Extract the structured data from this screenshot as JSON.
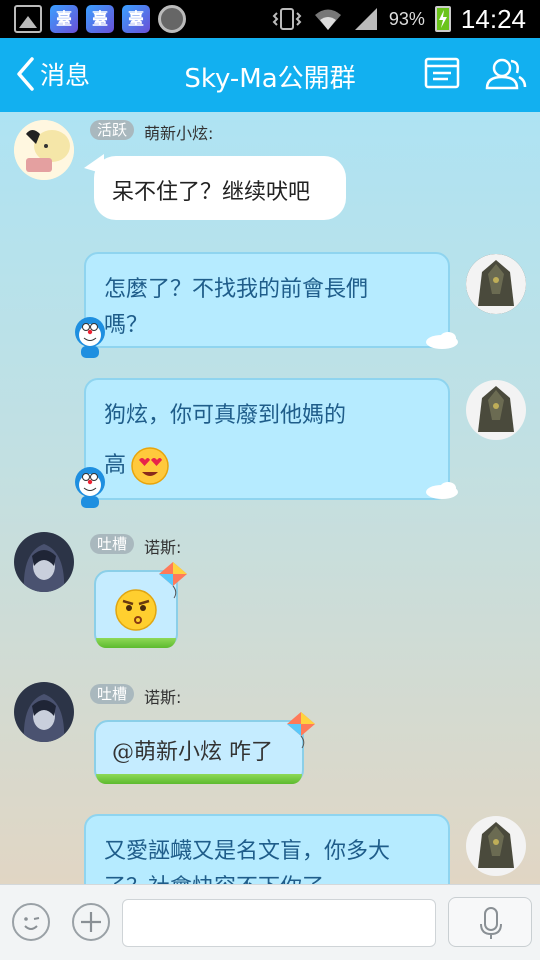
{
  "status_bar": {
    "battery_percent": "93%",
    "time": "14:24",
    "app_icon_label": "臺"
  },
  "header": {
    "back_label": "消息",
    "title": "Sky-Ma公開群"
  },
  "messages": [
    {
      "side": "left",
      "tag": "活跃",
      "sender": "萌新小炫:",
      "text": "呆不住了？继续吠吧"
    },
    {
      "side": "right",
      "line1": "怎麼了？不找我的前會長們",
      "line2": "嗎？"
    },
    {
      "side": "right",
      "line1": "狗炫，你可真廢到他媽的",
      "line2": "高"
    },
    {
      "side": "left",
      "tag": "吐槽",
      "sender": "诺斯:"
    },
    {
      "side": "left",
      "tag": "吐槽",
      "sender": "诺斯:",
      "text": "@萌新小炫 咋了"
    },
    {
      "side": "right",
      "line1": "又愛誣衊又是名文盲，你多大",
      "line2": "了？社會快容不下你了"
    }
  ],
  "input": {
    "placeholder": ""
  },
  "colors": {
    "header": "#12b0f0",
    "tag": "#a9b8be",
    "bubble_blue": "#b6ebff"
  }
}
